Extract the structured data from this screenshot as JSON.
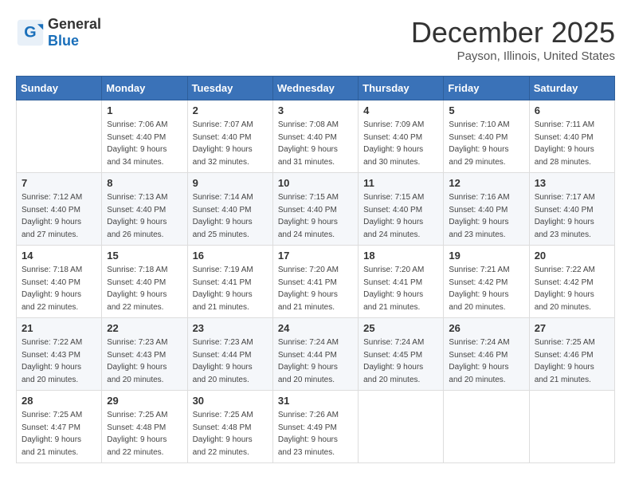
{
  "header": {
    "logo_general": "General",
    "logo_blue": "Blue",
    "month_title": "December 2025",
    "location": "Payson, Illinois, United States"
  },
  "weekdays": [
    "Sunday",
    "Monday",
    "Tuesday",
    "Wednesday",
    "Thursday",
    "Friday",
    "Saturday"
  ],
  "weeks": [
    [
      {
        "day": "",
        "info": ""
      },
      {
        "day": "1",
        "info": "Sunrise: 7:06 AM\nSunset: 4:40 PM\nDaylight: 9 hours\nand 34 minutes."
      },
      {
        "day": "2",
        "info": "Sunrise: 7:07 AM\nSunset: 4:40 PM\nDaylight: 9 hours\nand 32 minutes."
      },
      {
        "day": "3",
        "info": "Sunrise: 7:08 AM\nSunset: 4:40 PM\nDaylight: 9 hours\nand 31 minutes."
      },
      {
        "day": "4",
        "info": "Sunrise: 7:09 AM\nSunset: 4:40 PM\nDaylight: 9 hours\nand 30 minutes."
      },
      {
        "day": "5",
        "info": "Sunrise: 7:10 AM\nSunset: 4:40 PM\nDaylight: 9 hours\nand 29 minutes."
      },
      {
        "day": "6",
        "info": "Sunrise: 7:11 AM\nSunset: 4:40 PM\nDaylight: 9 hours\nand 28 minutes."
      }
    ],
    [
      {
        "day": "7",
        "info": "Sunrise: 7:12 AM\nSunset: 4:40 PM\nDaylight: 9 hours\nand 27 minutes."
      },
      {
        "day": "8",
        "info": "Sunrise: 7:13 AM\nSunset: 4:40 PM\nDaylight: 9 hours\nand 26 minutes."
      },
      {
        "day": "9",
        "info": "Sunrise: 7:14 AM\nSunset: 4:40 PM\nDaylight: 9 hours\nand 25 minutes."
      },
      {
        "day": "10",
        "info": "Sunrise: 7:15 AM\nSunset: 4:40 PM\nDaylight: 9 hours\nand 24 minutes."
      },
      {
        "day": "11",
        "info": "Sunrise: 7:15 AM\nSunset: 4:40 PM\nDaylight: 9 hours\nand 24 minutes."
      },
      {
        "day": "12",
        "info": "Sunrise: 7:16 AM\nSunset: 4:40 PM\nDaylight: 9 hours\nand 23 minutes."
      },
      {
        "day": "13",
        "info": "Sunrise: 7:17 AM\nSunset: 4:40 PM\nDaylight: 9 hours\nand 23 minutes."
      }
    ],
    [
      {
        "day": "14",
        "info": "Sunrise: 7:18 AM\nSunset: 4:40 PM\nDaylight: 9 hours\nand 22 minutes."
      },
      {
        "day": "15",
        "info": "Sunrise: 7:18 AM\nSunset: 4:40 PM\nDaylight: 9 hours\nand 22 minutes."
      },
      {
        "day": "16",
        "info": "Sunrise: 7:19 AM\nSunset: 4:41 PM\nDaylight: 9 hours\nand 21 minutes."
      },
      {
        "day": "17",
        "info": "Sunrise: 7:20 AM\nSunset: 4:41 PM\nDaylight: 9 hours\nand 21 minutes."
      },
      {
        "day": "18",
        "info": "Sunrise: 7:20 AM\nSunset: 4:41 PM\nDaylight: 9 hours\nand 21 minutes."
      },
      {
        "day": "19",
        "info": "Sunrise: 7:21 AM\nSunset: 4:42 PM\nDaylight: 9 hours\nand 20 minutes."
      },
      {
        "day": "20",
        "info": "Sunrise: 7:22 AM\nSunset: 4:42 PM\nDaylight: 9 hours\nand 20 minutes."
      }
    ],
    [
      {
        "day": "21",
        "info": "Sunrise: 7:22 AM\nSunset: 4:43 PM\nDaylight: 9 hours\nand 20 minutes."
      },
      {
        "day": "22",
        "info": "Sunrise: 7:23 AM\nSunset: 4:43 PM\nDaylight: 9 hours\nand 20 minutes."
      },
      {
        "day": "23",
        "info": "Sunrise: 7:23 AM\nSunset: 4:44 PM\nDaylight: 9 hours\nand 20 minutes."
      },
      {
        "day": "24",
        "info": "Sunrise: 7:24 AM\nSunset: 4:44 PM\nDaylight: 9 hours\nand 20 minutes."
      },
      {
        "day": "25",
        "info": "Sunrise: 7:24 AM\nSunset: 4:45 PM\nDaylight: 9 hours\nand 20 minutes."
      },
      {
        "day": "26",
        "info": "Sunrise: 7:24 AM\nSunset: 4:46 PM\nDaylight: 9 hours\nand 20 minutes."
      },
      {
        "day": "27",
        "info": "Sunrise: 7:25 AM\nSunset: 4:46 PM\nDaylight: 9 hours\nand 21 minutes."
      }
    ],
    [
      {
        "day": "28",
        "info": "Sunrise: 7:25 AM\nSunset: 4:47 PM\nDaylight: 9 hours\nand 21 minutes."
      },
      {
        "day": "29",
        "info": "Sunrise: 7:25 AM\nSunset: 4:48 PM\nDaylight: 9 hours\nand 22 minutes."
      },
      {
        "day": "30",
        "info": "Sunrise: 7:25 AM\nSunset: 4:48 PM\nDaylight: 9 hours\nand 22 minutes."
      },
      {
        "day": "31",
        "info": "Sunrise: 7:26 AM\nSunset: 4:49 PM\nDaylight: 9 hours\nand 23 minutes."
      },
      {
        "day": "",
        "info": ""
      },
      {
        "day": "",
        "info": ""
      },
      {
        "day": "",
        "info": ""
      }
    ]
  ]
}
